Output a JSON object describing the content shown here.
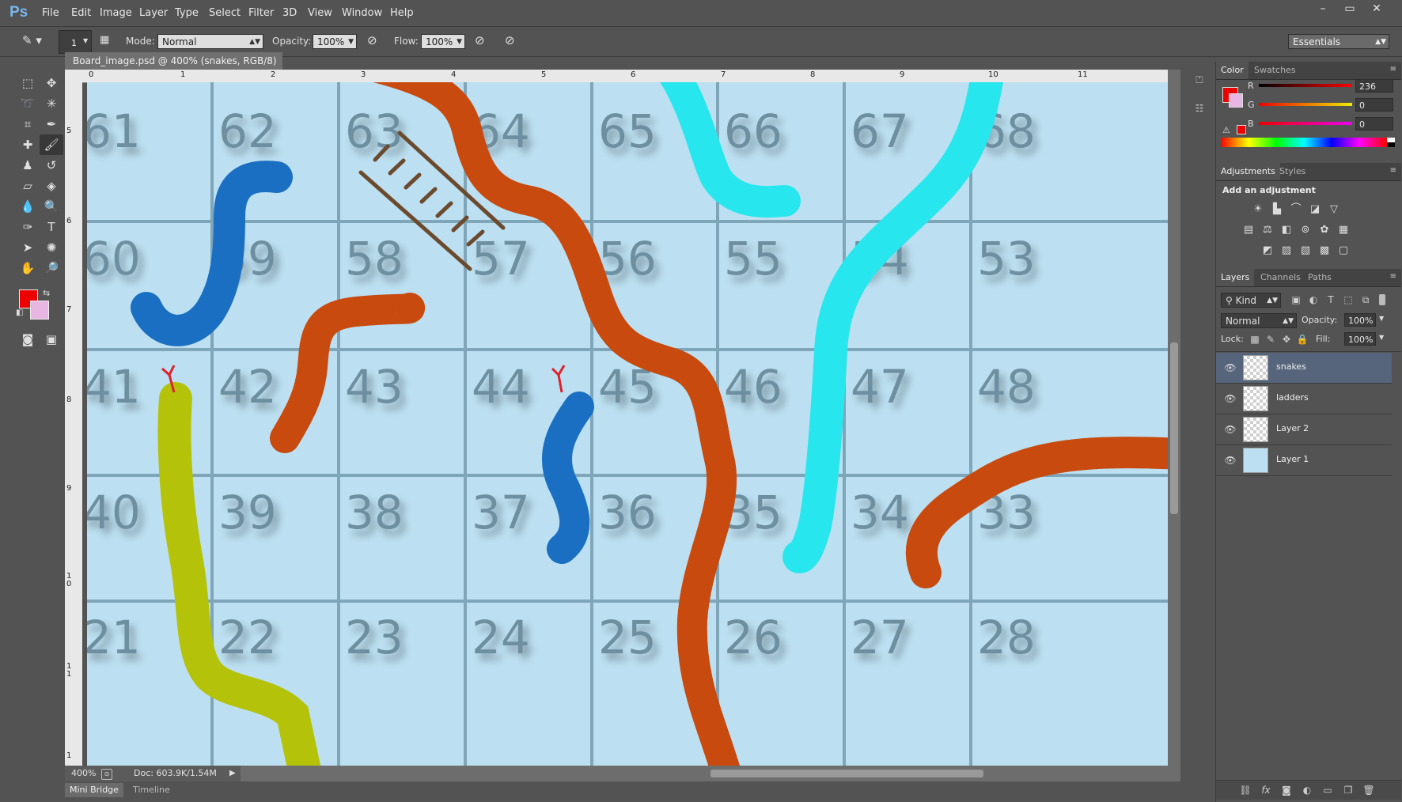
{
  "app": {
    "logo": "Ps",
    "menu": [
      "File",
      "Edit",
      "Image",
      "Layer",
      "Type",
      "Select",
      "Filter",
      "3D",
      "View",
      "Window",
      "Help"
    ],
    "window_controls": [
      "–",
      "▭",
      "✕"
    ]
  },
  "options_bar": {
    "brush_size": "1",
    "mode_label": "Mode:",
    "mode_value": "Normal",
    "opacity_label": "Opacity:",
    "opacity_value": "100%",
    "flow_label": "Flow:",
    "flow_value": "100%",
    "workspace": "Essentials"
  },
  "document": {
    "tab_title": "Board_image.psd @ 400% (snakes, RGB/8) *",
    "tab_close": "×",
    "ruler_h": [
      "0",
      "1",
      "2",
      "3",
      "4",
      "5",
      "6",
      "7",
      "8",
      "9",
      "10",
      "11"
    ],
    "ruler_v": [
      "5",
      "6",
      "7",
      "8",
      "9",
      "1 0",
      "1 1",
      "1"
    ],
    "board_rows": [
      [
        "61",
        "62",
        "63",
        "64",
        "65",
        "66",
        "67",
        "68"
      ],
      [
        "60",
        "59",
        "58",
        "57",
        "56",
        "55",
        "54",
        "53"
      ],
      [
        "41",
        "42",
        "43",
        "44",
        "45",
        "46",
        "47",
        "48"
      ],
      [
        "40",
        "39",
        "38",
        "37",
        "36",
        "35",
        "34",
        "33"
      ],
      [
        "21",
        "22",
        "23",
        "24",
        "25",
        "26",
        "27",
        "28"
      ]
    ],
    "colors": {
      "board": "#bce0f1",
      "grid": "#7fa5b8",
      "numbers": "#6e8fa0",
      "snake_orange": "#c84a0e",
      "snake_blue": "#1a6fc2",
      "snake_cyan": "#28e6ee",
      "snake_yellow": "#b4c20a",
      "ladder": "#6b4a2e"
    }
  },
  "status_bar": {
    "zoom": "400%",
    "doc_size": "Doc: 603.9K/1.54M"
  },
  "bottom_tabs": [
    "Mini Bridge",
    "Timeline"
  ],
  "color_panel": {
    "tabs": [
      "Color",
      "Swatches"
    ],
    "channels": [
      {
        "label": "R",
        "value": "236"
      },
      {
        "label": "G",
        "value": "0"
      },
      {
        "label": "B",
        "value": "0"
      }
    ],
    "foreground": "#ec0000",
    "background": "#e9b5e2"
  },
  "adjustments_panel": {
    "tabs": [
      "Adjustments",
      "Styles"
    ],
    "heading": "Add an adjustment",
    "icons": [
      "brightness-icon",
      "levels-icon",
      "curves-icon",
      "exposure-icon",
      "vibrance-icon",
      "hue-saturation-icon",
      "color-balance-icon",
      "black-white-icon",
      "photo-filter-icon",
      "channel-mixer-icon",
      "color-lookup-icon",
      "invert-icon",
      "posterize-icon",
      "threshold-icon",
      "gradient-map-icon",
      "selective-color-icon"
    ]
  },
  "layers_panel": {
    "tabs": [
      "Layers",
      "Channels",
      "Paths"
    ],
    "kind": "Kind",
    "blend_mode": "Normal",
    "opacity_label": "Opacity:",
    "opacity_value": "100%",
    "lock_label": "Lock:",
    "fill_label": "Fill:",
    "fill_value": "100%",
    "layers": [
      {
        "name": "snakes",
        "selected": true
      },
      {
        "name": "ladders",
        "selected": false
      },
      {
        "name": "Layer 2",
        "selected": false
      },
      {
        "name": "Layer 1",
        "selected": false
      }
    ]
  }
}
